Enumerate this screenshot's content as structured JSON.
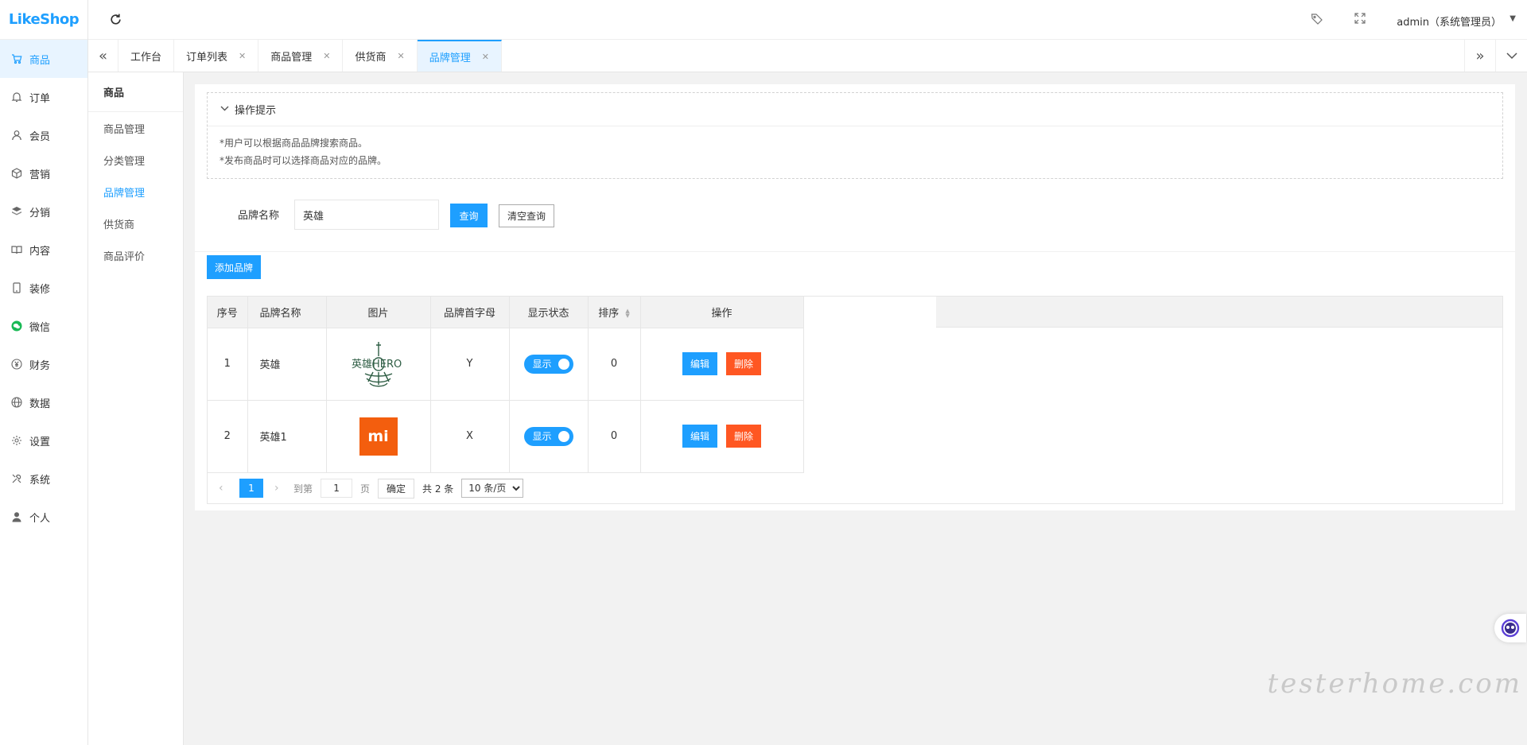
{
  "app": {
    "logo_text": "LikeShop"
  },
  "leftnav": {
    "items": [
      {
        "label": "商品",
        "icon": "cart-icon"
      },
      {
        "label": "订单",
        "icon": "bell-icon"
      },
      {
        "label": "会员",
        "icon": "user-icon"
      },
      {
        "label": "营销",
        "icon": "cube-icon"
      },
      {
        "label": "分销",
        "icon": "layers-icon"
      },
      {
        "label": "内容",
        "icon": "book-icon"
      },
      {
        "label": "装修",
        "icon": "tablet-icon"
      },
      {
        "label": "微信",
        "icon": "wechat-icon"
      },
      {
        "label": "财务",
        "icon": "yen-icon"
      },
      {
        "label": "数据",
        "icon": "globe-icon"
      },
      {
        "label": "设置",
        "icon": "gear-icon"
      },
      {
        "label": "系统",
        "icon": "tools-icon"
      },
      {
        "label": "个人",
        "icon": "person-icon"
      }
    ]
  },
  "header": {
    "user": "admin（系统管理员）"
  },
  "tabs": [
    {
      "label": "工作台",
      "closable": false
    },
    {
      "label": "订单列表",
      "closable": true
    },
    {
      "label": "商品管理",
      "closable": true
    },
    {
      "label": "供货商",
      "closable": true
    },
    {
      "label": "品牌管理",
      "closable": true
    }
  ],
  "subnav": {
    "title": "商品",
    "items": [
      "商品管理",
      "分类管理",
      "品牌管理",
      "供货商",
      "商品评价"
    ]
  },
  "tips": {
    "title": "操作提示",
    "lines": [
      "*用户可以根据商品品牌搜索商品。",
      "*发布商品时可以选择商品对应的品牌。"
    ]
  },
  "search": {
    "label": "品牌名称",
    "value": "英雄",
    "query_btn": "查询",
    "clear_btn": "清空查询"
  },
  "add_btn": "添加品牌",
  "table": {
    "headers": [
      "序号",
      "品牌名称",
      "图片",
      "品牌首字母",
      "显示状态",
      "排序",
      "操作"
    ],
    "rows": [
      {
        "index": "1",
        "name": "英雄",
        "logo_text": "英雄HERO",
        "initial": "Y",
        "status": "显示",
        "sort": "0"
      },
      {
        "index": "2",
        "name": "英雄1",
        "logo_text": "mi",
        "initial": "X",
        "status": "显示",
        "sort": "0"
      }
    ],
    "edit_btn": "编辑",
    "delete_btn": "删除"
  },
  "pager": {
    "current": "1",
    "goto_label": "到第",
    "goto_value": "1",
    "page_unit": "页",
    "confirm": "确定",
    "total": "共 2 条",
    "page_size": "10 条/页"
  },
  "watermark": "testerhome.com",
  "colors": {
    "primary": "#1e9fff",
    "danger": "#ff5722",
    "mi_orange": "#f35e0e"
  }
}
